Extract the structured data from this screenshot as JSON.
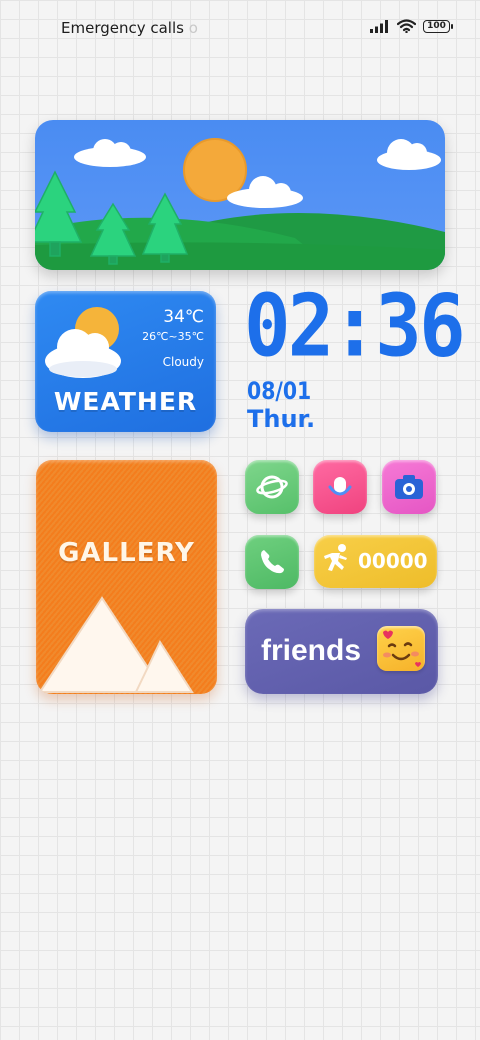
{
  "status_bar": {
    "carrier_text": "Emergency calls",
    "carrier_fade": "o",
    "battery": "100",
    "icons": [
      "signal-icon",
      "wifi-icon",
      "battery-icon"
    ]
  },
  "weather": {
    "temperature": "34℃",
    "range": "26℃~35℃",
    "condition": "Cloudy",
    "title": "WEATHER"
  },
  "clock": {
    "time": "02:36",
    "date": "08/01",
    "day": "Thur."
  },
  "gallery": {
    "title": "GALLERY"
  },
  "apps": {
    "browser": "browser-icon",
    "recorder": "recorder-icon",
    "camera": "camera-icon",
    "phone": "phone-icon"
  },
  "steps": {
    "count": "00000"
  },
  "friends": {
    "label": "friends"
  },
  "colors": {
    "accent_blue": "#1d6fea",
    "gallery_orange": "#f47d1d",
    "friends_purple": "#5a58a6",
    "steps_yellow": "#f2c233"
  }
}
